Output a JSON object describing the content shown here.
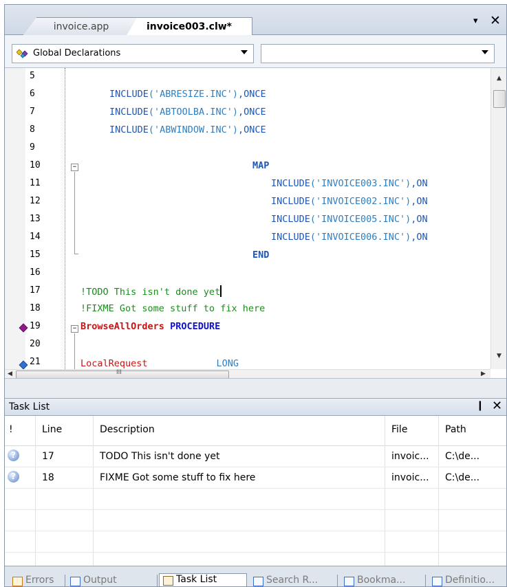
{
  "tabs": {
    "items": [
      {
        "label": "invoice.app"
      },
      {
        "label": "invoice003.clw*"
      }
    ],
    "menu_icon": "▾",
    "close_icon": "✕"
  },
  "dropdowns": {
    "left_value": "Global Declarations",
    "right_value": ""
  },
  "editor": {
    "line_numbers": [
      "5",
      "6",
      "7",
      "8",
      "9",
      "10",
      "11",
      "12",
      "13",
      "14",
      "15",
      "16",
      "17",
      "18",
      "19",
      "20",
      "21"
    ],
    "code": {
      "l6_kw": "INCLUDE",
      "l6_str": "('ABRESIZE.INC')",
      "l6_tail": ",ONCE",
      "l7_kw": "INCLUDE",
      "l7_str": "('ABTOOLBA.INC')",
      "l7_tail": ",ONCE",
      "l8_kw": "INCLUDE",
      "l8_str": "('ABWINDOW.INC')",
      "l8_tail": ",ONCE",
      "l10_kw": "MAP",
      "l11_kw": "INCLUDE",
      "l11_str": "('INVOICE003.INC')",
      "l11_tail": ",ON",
      "l12_kw": "INCLUDE",
      "l12_str": "('INVOICE002.INC')",
      "l12_tail": ",ON",
      "l13_kw": "INCLUDE",
      "l13_str": "('INVOICE005.INC')",
      "l13_tail": ",ON",
      "l14_kw": "INCLUDE",
      "l14_str": "('INVOICE006.INC')",
      "l14_tail": ",ON",
      "l15_kw": "END",
      "l17_cmt": "!TODO This isn't done yet",
      "l18_cmt": "!FIXME Got some stuff to fix here",
      "l19_proc": "BrowseAllOrders",
      "l19_kw": "PROCEDURE",
      "l21_lbl": "LocalRequest",
      "l21_kw": "LONG"
    },
    "hscroll_grip": "III"
  },
  "task_list": {
    "title": "Task List",
    "pin_icon": "❙",
    "close_icon": "✕",
    "columns": [
      "!",
      "Line",
      "Description",
      "File",
      "Path"
    ],
    "rows": [
      {
        "icon": "?",
        "line": "17",
        "description": "TODO This isn't done yet",
        "file": "invoic...",
        "path": "C:\\de..."
      },
      {
        "icon": "?",
        "line": "18",
        "description": "FIXME Got some stuff to fix here",
        "file": "invoic...",
        "path": "C:\\de..."
      }
    ]
  },
  "bottom_tabs": [
    {
      "label": "Errors"
    },
    {
      "label": "Output"
    },
    {
      "label": "Task List"
    },
    {
      "label": "Search R..."
    },
    {
      "label": "Bookma..."
    },
    {
      "label": "Definitio..."
    }
  ],
  "colors": {
    "keyword": "#1d56b7",
    "string": "#2e7fc1",
    "comment": "#1b8c1b",
    "procedure": "#c81414"
  }
}
